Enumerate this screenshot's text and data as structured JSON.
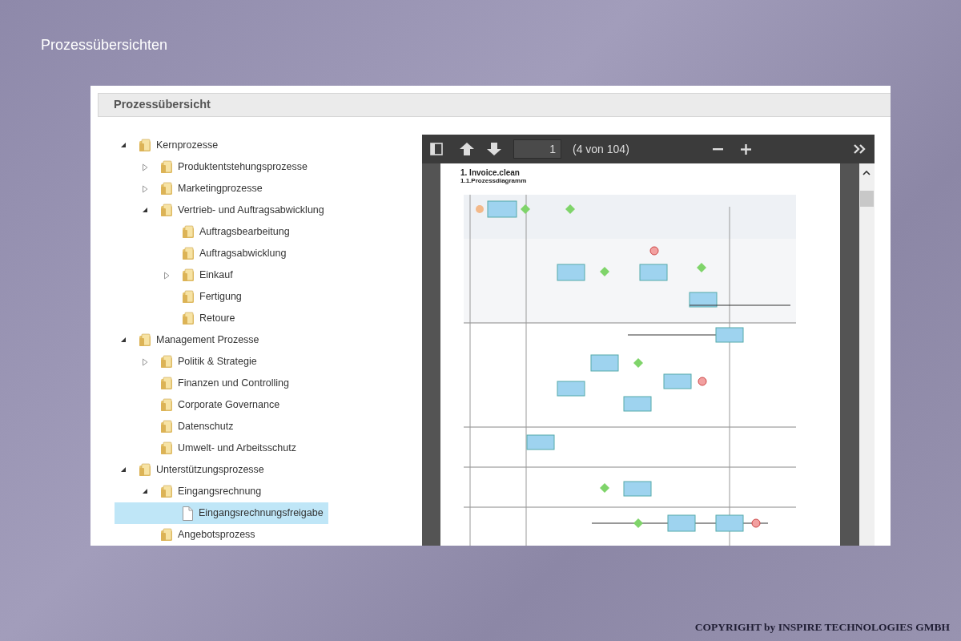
{
  "slide_title": "Prozessübersichten",
  "panel": {
    "title": "Prozessübersicht",
    "tree": [
      {
        "label": "Kernprozesse",
        "kind": "folder",
        "expanded": true,
        "selected": false,
        "children": [
          {
            "label": "Produktentstehungsprozesse",
            "kind": "folder",
            "expanded": false,
            "selected": false
          },
          {
            "label": "Marketingprozesse",
            "kind": "folder",
            "expanded": false,
            "selected": false
          },
          {
            "label": "Vertrieb- und Auftragsabwicklung",
            "kind": "folder",
            "expanded": true,
            "selected": false,
            "children": [
              {
                "label": "Auftragsbearbeitung",
                "kind": "folder",
                "selected": false
              },
              {
                "label": "Auftragsabwicklung",
                "kind": "folder",
                "selected": false
              },
              {
                "label": "Einkauf",
                "kind": "folder",
                "expanded": false,
                "selected": false
              },
              {
                "label": "Fertigung",
                "kind": "folder",
                "selected": false
              },
              {
                "label": "Retoure",
                "kind": "folder",
                "selected": false
              }
            ]
          }
        ]
      },
      {
        "label": "Management Prozesse",
        "kind": "folder",
        "expanded": true,
        "selected": false,
        "children": [
          {
            "label": "Politik & Strategie",
            "kind": "folder",
            "expanded": false,
            "selected": false
          },
          {
            "label": "Finanzen und Controlling",
            "kind": "folder",
            "selected": false
          },
          {
            "label": "Corporate Governance",
            "kind": "folder",
            "selected": false
          },
          {
            "label": "Datenschutz",
            "kind": "folder",
            "selected": false
          },
          {
            "label": "Umwelt- und Arbeitsschutz",
            "kind": "folder",
            "selected": false
          }
        ]
      },
      {
        "label": "Unterstützungsprozesse",
        "kind": "folder",
        "expanded": true,
        "selected": false,
        "children": [
          {
            "label": "Eingangsrechnung",
            "kind": "folder",
            "expanded": true,
            "selected": false,
            "children": [
              {
                "label": "Eingangsrechnungsfreigabe",
                "kind": "document",
                "selected": true
              }
            ]
          },
          {
            "label": "Angebotsprozess",
            "kind": "folder",
            "selected": false
          }
        ]
      }
    ],
    "viewer": {
      "page_number": "1",
      "page_count": "(4 von 104)",
      "heading": "1. Invoice.clean",
      "subheading": "1.1.Prozessdiagramm"
    }
  },
  "footer": "COPYRIGHT by INSPIRE TECHNOLOGIES GMBH"
}
